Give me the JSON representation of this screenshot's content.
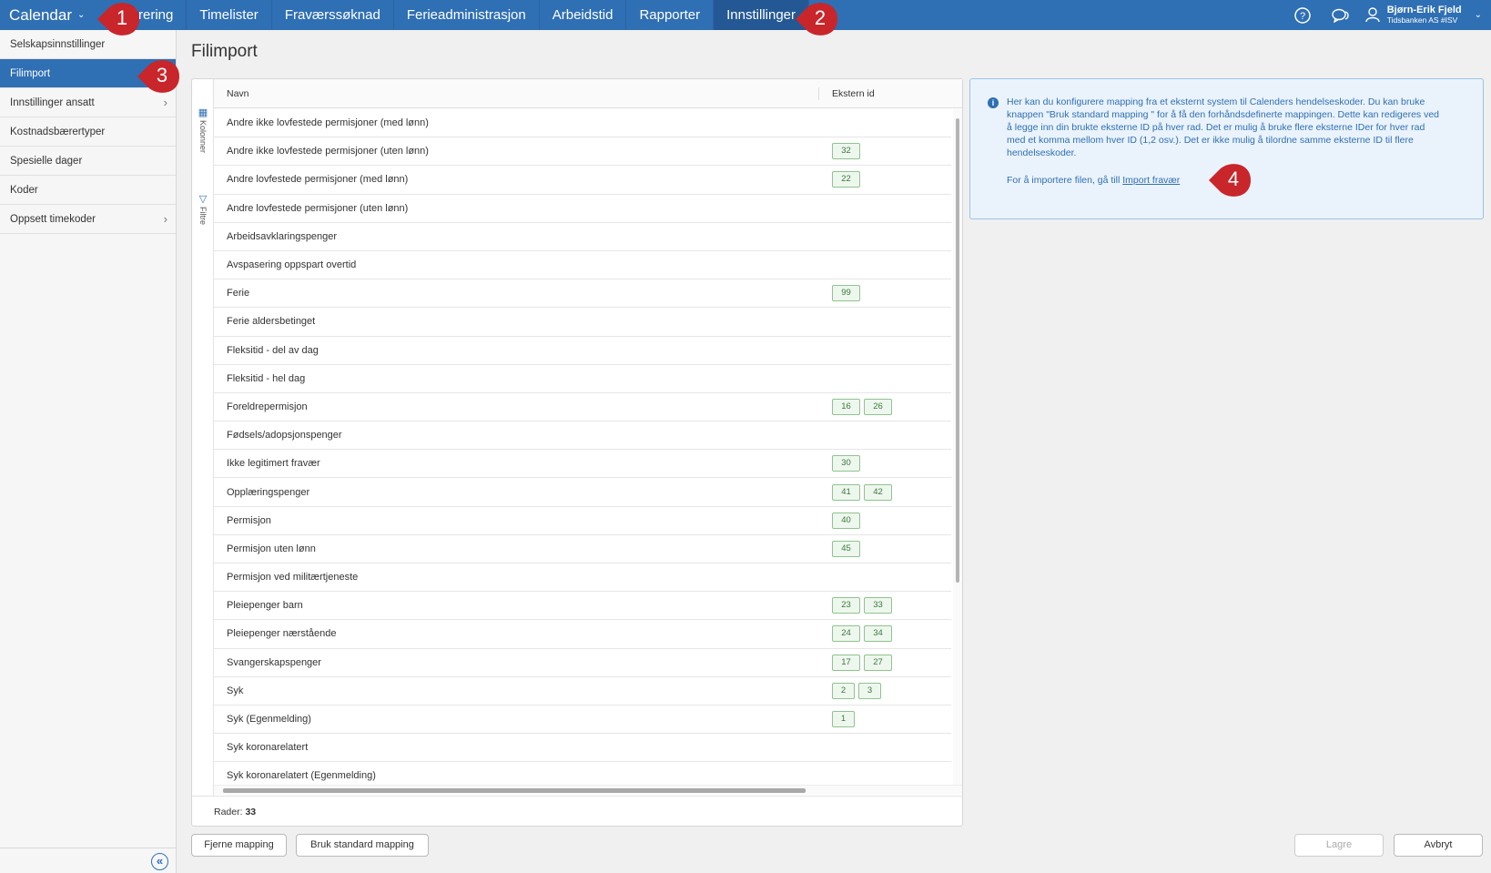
{
  "topnav": {
    "brand": "Calendar",
    "tabs": [
      {
        "label": "rering"
      },
      {
        "label": "Timelister"
      },
      {
        "label": "Fraværssøknad"
      },
      {
        "label": "Ferieadministrasjon"
      },
      {
        "label": "Arbeidstid"
      },
      {
        "label": "Rapporter"
      },
      {
        "label": "Innstillinger"
      }
    ],
    "active_tab": "Innstillinger",
    "user_name": "Bjørn-Erik Fjeld",
    "user_company": "Tidsbanken AS #ISV",
    "icons": [
      "help-icon",
      "chat-icon",
      "user-icon"
    ]
  },
  "sidebar": {
    "items": [
      {
        "label": "Selskapsinnstillinger",
        "has_chevron": false
      },
      {
        "label": "Filimport",
        "has_chevron": false,
        "active": true
      },
      {
        "label": "Innstillinger ansatt",
        "has_chevron": true
      },
      {
        "label": "Kostnadsbærertyper",
        "has_chevron": false
      },
      {
        "label": "Spesielle dager",
        "has_chevron": false
      },
      {
        "label": "Koder",
        "has_chevron": false
      },
      {
        "label": "Oppsett timekoder",
        "has_chevron": true
      }
    ]
  },
  "page": {
    "title": "Filimport"
  },
  "grid": {
    "side_tools": {
      "columns": "Kolonner",
      "filters": "Filtre"
    },
    "columns": {
      "name": "Navn",
      "external_id": "Ekstern id"
    },
    "rows": [
      {
        "name": "Andre ikke lovfestede permisjoner (med lønn)",
        "ids": []
      },
      {
        "name": "Andre ikke lovfestede permisjoner (uten lønn)",
        "ids": [
          "32"
        ]
      },
      {
        "name": "Andre lovfestede permisjoner (med lønn)",
        "ids": [
          "22"
        ]
      },
      {
        "name": "Andre lovfestede permisjoner (uten lønn)",
        "ids": []
      },
      {
        "name": "Arbeidsavklaringspenger",
        "ids": []
      },
      {
        "name": "Avspasering oppspart overtid",
        "ids": []
      },
      {
        "name": "Ferie",
        "ids": [
          "99"
        ]
      },
      {
        "name": "Ferie aldersbetinget",
        "ids": []
      },
      {
        "name": "Fleksitid - del av dag",
        "ids": []
      },
      {
        "name": "Fleksitid - hel dag",
        "ids": []
      },
      {
        "name": "Foreldrepermisjon",
        "ids": [
          "16",
          "26"
        ]
      },
      {
        "name": "Fødsels/adopsjonspenger",
        "ids": []
      },
      {
        "name": "Ikke legitimert fravær",
        "ids": [
          "30"
        ]
      },
      {
        "name": "Opplæringspenger",
        "ids": [
          "41",
          "42"
        ]
      },
      {
        "name": "Permisjon",
        "ids": [
          "40"
        ]
      },
      {
        "name": "Permisjon uten lønn",
        "ids": [
          "45"
        ]
      },
      {
        "name": "Permisjon ved militærtjeneste",
        "ids": []
      },
      {
        "name": "Pleiepenger barn",
        "ids": [
          "23",
          "33"
        ]
      },
      {
        "name": "Pleiepenger nærstående",
        "ids": [
          "24",
          "34"
        ]
      },
      {
        "name": "Svangerskapspenger",
        "ids": [
          "17",
          "27"
        ]
      },
      {
        "name": "Syk",
        "ids": [
          "2",
          "3"
        ]
      },
      {
        "name": "Syk (Egenmelding)",
        "ids": [
          "1"
        ]
      },
      {
        "name": "Syk koronarelatert",
        "ids": []
      },
      {
        "name": "Syk koronarelatert (Egenmelding)",
        "ids": []
      }
    ],
    "footer_label": "Rader:",
    "row_count": "33"
  },
  "info": {
    "text": "Her kan du konfigurere mapping fra et eksternt system til Calenders hendelseskoder. Du kan bruke knappen \"Bruk standard mapping \" for å få den forhåndsdefinerte mappingen. Dette kan redigeres ved å legge inn din brukte eksterne ID på hver rad. Det er mulig å bruke flere eksterne IDer for hver rad med et komma mellom hver ID (1,2 osv.). Det er ikke mulig å tilordne samme eksterne ID til flere hendelseskoder.",
    "import_prefix": "For å importere filen, gå till",
    "import_link": "Import fravær"
  },
  "buttons": {
    "remove_mapping": "Fjerne mapping",
    "use_standard": "Bruk standard mapping",
    "save": "Lagre",
    "cancel": "Avbryt"
  },
  "markers": [
    "1",
    "2",
    "3",
    "4"
  ],
  "colors": {
    "primary": "#2f6fb4",
    "marker": "#c8262b",
    "tag_border": "#8fc38f"
  }
}
